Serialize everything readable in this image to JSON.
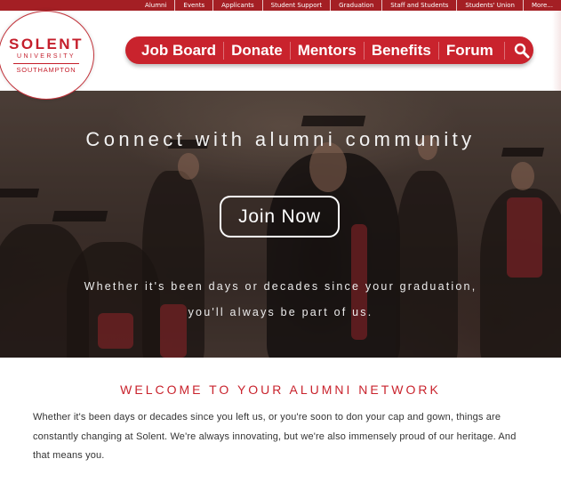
{
  "top_links": [
    "Alumni",
    "Events",
    "Applicants",
    "Student Support",
    "Graduation",
    "Staff and Students",
    "Students' Union",
    "More..."
  ],
  "logo": {
    "line1": "SOLENT",
    "line2": "UNIVERSITY",
    "line3": "SOUTHAMPTON"
  },
  "nav": {
    "items": [
      "Job Board",
      "Donate",
      "Mentors",
      "Benefits",
      "Forum"
    ],
    "search_icon": "search-icon"
  },
  "hero": {
    "title": "Connect with alumni community",
    "button": "Join Now",
    "subtitle_line1": "Whether it's been days or decades since your graduation,",
    "subtitle_line2": "you'll always be part of us."
  },
  "welcome": {
    "heading": "WELCOME TO YOUR ALUMNI NETWORK",
    "body": "Whether it's been days or decades since you left us, or you're soon to don your cap and gown, things are constantly changing at Solent. We're always innovating, but we're also immensely proud of our heritage. And that means you."
  },
  "colors": {
    "brand_red": "#c9232d",
    "topbar_red": "#a41f24"
  }
}
